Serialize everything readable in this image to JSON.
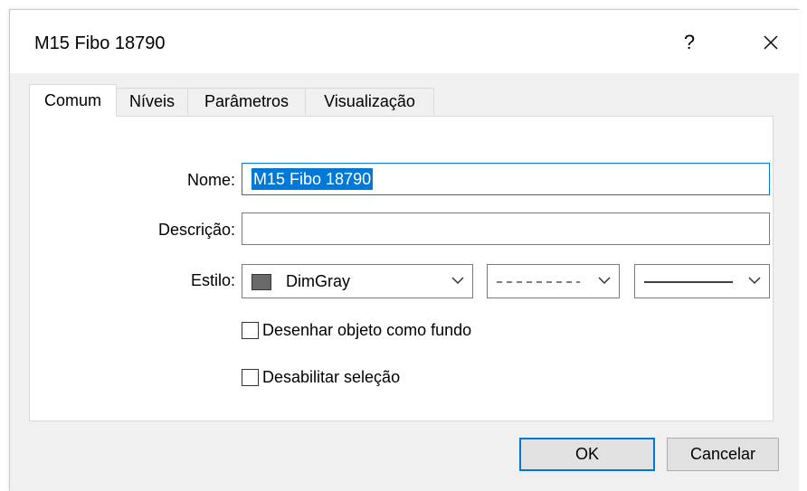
{
  "window": {
    "title": "M15 Fibo 18790",
    "help_label": "?"
  },
  "tabs": [
    {
      "label": "Comum",
      "active": true
    },
    {
      "label": "Níveis",
      "active": false
    },
    {
      "label": "Parâmetros",
      "active": false
    },
    {
      "label": "Visualização",
      "active": false
    }
  ],
  "form": {
    "name_label": "Nome:",
    "name_value": "M15 Fibo 18790",
    "description_label": "Descrição:",
    "description_value": "",
    "style_label": "Estilo:",
    "color_value": "DimGray",
    "color_hex": "#696969",
    "line_style": "dashed",
    "line_width": "solid",
    "background_checkbox_label": "Desenhar objeto como fundo",
    "background_checked": false,
    "disable_selection_label": "Desabilitar seleção",
    "disable_selection_checked": false
  },
  "buttons": {
    "ok_label": "OK",
    "cancel_label": "Cancelar"
  }
}
